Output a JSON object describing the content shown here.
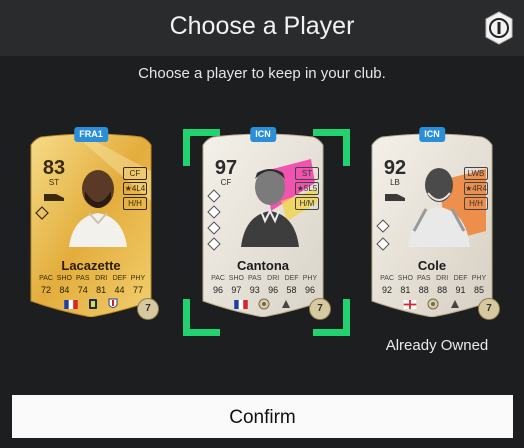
{
  "dialog": {
    "title": "Choose a Player",
    "subtitle": "Choose a player to keep in your club.",
    "owned_label": "Already Owned",
    "confirm_label": "Confirm"
  },
  "stat_labels": [
    "PAC",
    "SHO",
    "PAS",
    "DRI",
    "DEF",
    "PHY"
  ],
  "cards": [
    {
      "name": "Lacazette",
      "rating": "83",
      "position": "ST",
      "tag": "FRA1",
      "alt_position": "CF",
      "skill_weak": "★4L4",
      "work_rate": "H/H",
      "stats": [
        "72",
        "84",
        "74",
        "81",
        "44",
        "77"
      ],
      "chemistry": "7",
      "selected": false,
      "flag": "france"
    },
    {
      "name": "Cantona",
      "rating": "97",
      "position": "CF",
      "tag": "ICN",
      "alt_position": "ST",
      "skill_weak": "★5L5",
      "work_rate": "H/M",
      "stats": [
        "96",
        "97",
        "93",
        "96",
        "58",
        "96"
      ],
      "chemistry": "7",
      "selected": true,
      "flag": "france"
    },
    {
      "name": "Cole",
      "rating": "92",
      "position": "LB",
      "tag": "ICN",
      "alt_position": "LWB",
      "skill_weak": "★4R4",
      "work_rate": "H/H",
      "stats": [
        "92",
        "81",
        "88",
        "88",
        "91",
        "85"
      ],
      "chemistry": "7",
      "selected": false,
      "flag": "england"
    }
  ],
  "colors": {
    "gold_card": "#e8b94c",
    "icon_card": "#ece7df",
    "selection": "#21d36e",
    "icon_tag": "#2a8fd8"
  }
}
